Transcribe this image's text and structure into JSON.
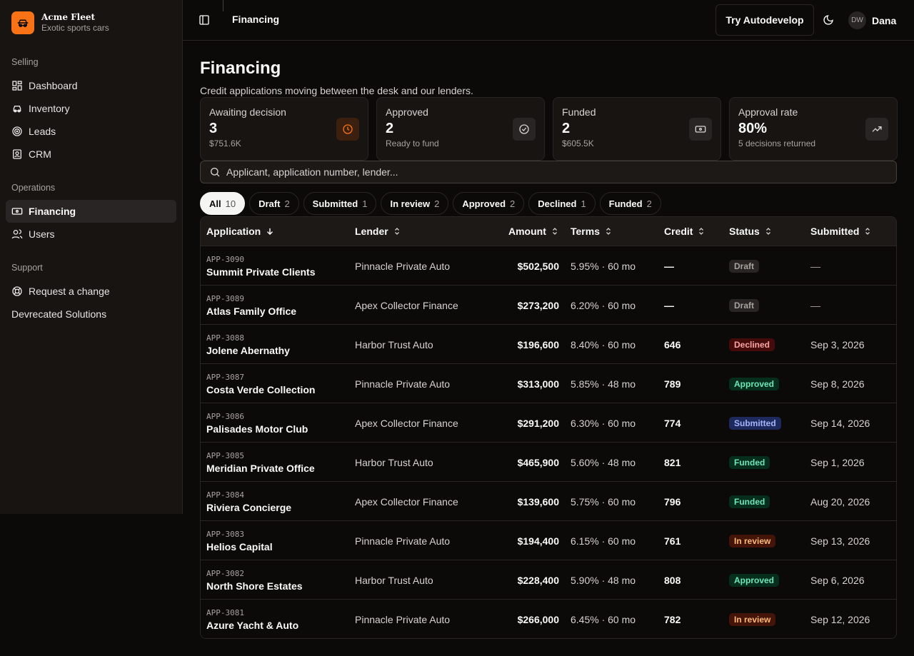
{
  "brand": {
    "name": "Acme Fleet",
    "tagline": "Exotic sports cars",
    "accent": "#f97316"
  },
  "sidebar": {
    "groups": [
      {
        "label": "Selling",
        "items": [
          {
            "label": "Dashboard",
            "icon": "dashboard-icon"
          },
          {
            "label": "Inventory",
            "icon": "car-icon"
          },
          {
            "label": "Leads",
            "icon": "target-icon"
          },
          {
            "label": "CRM",
            "icon": "contact-icon"
          }
        ]
      },
      {
        "label": "Operations",
        "items": [
          {
            "label": "Financing",
            "icon": "banknote-icon",
            "active": true
          },
          {
            "label": "Users",
            "icon": "users-icon"
          }
        ]
      },
      {
        "label": "Support",
        "items": [
          {
            "label": "Request a change",
            "icon": "lifebuoy-icon"
          },
          {
            "label": "Devrecated Solutions",
            "icon": ""
          }
        ]
      }
    ]
  },
  "topbar": {
    "title": "Financing",
    "cta": "Try Autodevelop",
    "user": {
      "initials": "DW",
      "name": "Dana"
    }
  },
  "page": {
    "title": "Financing",
    "subtitle": "Credit applications moving between the desk and our lenders."
  },
  "stats": [
    {
      "label": "Awaiting decision",
      "value": "3",
      "sub": "$751.6K",
      "icon": "clock-icon"
    },
    {
      "label": "Approved",
      "value": "2",
      "sub": "Ready to fund",
      "icon": "check-circle-icon"
    },
    {
      "label": "Funded",
      "value": "2",
      "sub": "$605.5K",
      "icon": "banknote-icon"
    },
    {
      "label": "Approval rate",
      "value": "80%",
      "sub": "5 decisions returned",
      "icon": "trending-up-icon"
    }
  ],
  "search": {
    "placeholder": "Applicant, application number, lender..."
  },
  "tabs": [
    {
      "label": "All",
      "count": "10",
      "active": true
    },
    {
      "label": "Draft",
      "count": "2"
    },
    {
      "label": "Submitted",
      "count": "1"
    },
    {
      "label": "In review",
      "count": "2"
    },
    {
      "label": "Approved",
      "count": "2"
    },
    {
      "label": "Declined",
      "count": "1"
    },
    {
      "label": "Funded",
      "count": "2"
    }
  ],
  "table": {
    "columns": [
      "Application",
      "Lender",
      "Amount",
      "Terms",
      "Credit",
      "Status",
      "Submitted"
    ],
    "rows": [
      {
        "num": "APP-3090",
        "name": "Summit Private Clients",
        "lender": "Pinnacle Private Auto",
        "amount": "$502,500",
        "terms": "5.95% · 60 mo",
        "credit": "—",
        "status": "Draft",
        "submitted": "—"
      },
      {
        "num": "APP-3089",
        "name": "Atlas Family Office",
        "lender": "Apex Collector Finance",
        "amount": "$273,200",
        "terms": "6.20% · 60 mo",
        "credit": "—",
        "status": "Draft",
        "submitted": "—"
      },
      {
        "num": "APP-3088",
        "name": "Jolene Abernathy",
        "lender": "Harbor Trust Auto",
        "amount": "$196,600",
        "terms": "8.40% · 60 mo",
        "credit": "646",
        "status": "Declined",
        "submitted": "Sep 3, 2026"
      },
      {
        "num": "APP-3087",
        "name": "Costa Verde Collection",
        "lender": "Pinnacle Private Auto",
        "amount": "$313,000",
        "terms": "5.85% · 48 mo",
        "credit": "789",
        "status": "Approved",
        "submitted": "Sep 8, 2026"
      },
      {
        "num": "APP-3086",
        "name": "Palisades Motor Club",
        "lender": "Apex Collector Finance",
        "amount": "$291,200",
        "terms": "6.30% · 60 mo",
        "credit": "774",
        "status": "Submitted",
        "submitted": "Sep 14, 2026"
      },
      {
        "num": "APP-3085",
        "name": "Meridian Private Office",
        "lender": "Harbor Trust Auto",
        "amount": "$465,900",
        "terms": "5.60% · 48 mo",
        "credit": "821",
        "status": "Funded",
        "submitted": "Sep 1, 2026"
      },
      {
        "num": "APP-3084",
        "name": "Riviera Concierge",
        "lender": "Apex Collector Finance",
        "amount": "$139,600",
        "terms": "5.75% · 60 mo",
        "credit": "796",
        "status": "Funded",
        "submitted": "Aug 20, 2026"
      },
      {
        "num": "APP-3083",
        "name": "Helios Capital",
        "lender": "Pinnacle Private Auto",
        "amount": "$194,400",
        "terms": "6.15% · 60 mo",
        "credit": "761",
        "status": "In review",
        "submitted": "Sep 13, 2026"
      },
      {
        "num": "APP-3082",
        "name": "North Shore Estates",
        "lender": "Harbor Trust Auto",
        "amount": "$228,400",
        "terms": "5.90% · 48 mo",
        "credit": "808",
        "status": "Approved",
        "submitted": "Sep 6, 2026"
      },
      {
        "num": "APP-3081",
        "name": "Azure Yacht & Auto",
        "lender": "Pinnacle Private Auto",
        "amount": "$266,000",
        "terms": "6.45% · 60 mo",
        "credit": "782",
        "status": "In review",
        "submitted": "Sep 12, 2026"
      }
    ]
  },
  "status_colors": {
    "Draft": {
      "bg": "#292524",
      "fg": "#a8a29e"
    },
    "Declined": {
      "bg": "#450a0a",
      "fg": "#fca5a5"
    },
    "Approved": {
      "bg": "#052e1c",
      "fg": "#6ee7b7"
    },
    "Submitted": {
      "bg": "#1e2a5e",
      "fg": "#a5b4fc"
    },
    "Funded": {
      "bg": "#052e1c",
      "fg": "#6ee7b7"
    },
    "In review": {
      "bg": "#431407",
      "fg": "#fdba74"
    }
  }
}
